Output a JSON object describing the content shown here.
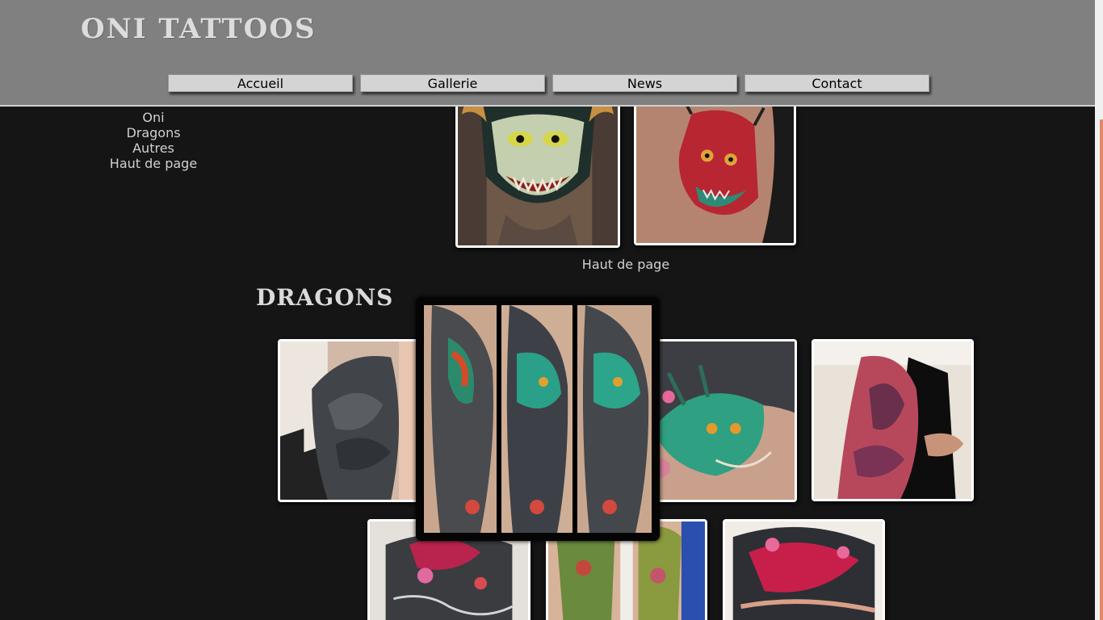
{
  "site": {
    "title": "ONI TATTOOS"
  },
  "nav": {
    "items": [
      {
        "label": "Accueil"
      },
      {
        "label": "Gallerie"
      },
      {
        "label": "News"
      },
      {
        "label": "Contact"
      }
    ]
  },
  "side_nav": {
    "items": [
      {
        "label": "Oni"
      },
      {
        "label": "Dragons"
      },
      {
        "label": "Autres"
      },
      {
        "label": "Haut de page"
      }
    ]
  },
  "oni_section": {
    "back_to_top": "Haut de page"
  },
  "dragons_section": {
    "title": "DRAGONS"
  },
  "colors": {
    "page_background": "#151515",
    "header_background": "#808080",
    "nav_button": "#d4d4d4",
    "link_text": "#d0d0d0",
    "scroll_thumb": "#e08a68"
  }
}
